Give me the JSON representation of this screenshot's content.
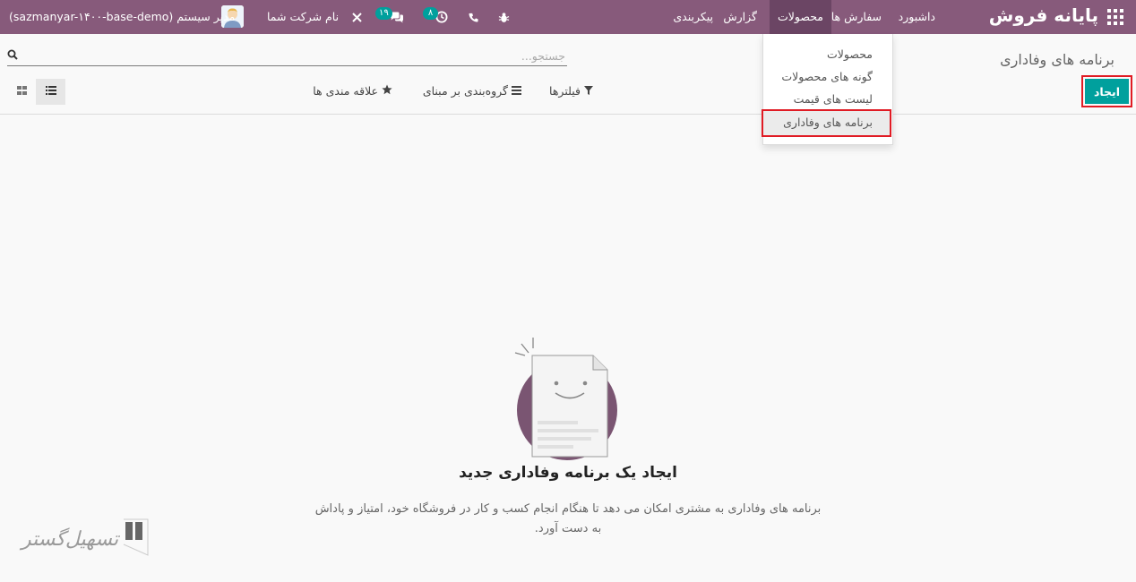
{
  "navbar": {
    "brand": "پایانه فروش",
    "menu": [
      "داشبورد",
      "سفارش ها",
      "محصولات",
      "گزارش",
      "پیکربندی"
    ],
    "active_menu": "محصولات",
    "chat_count": "۱۹",
    "activity_count": "۸",
    "company": "نام شرکت شما",
    "user": "مدیر سیستم (sazmanyar-۱۴۰۰-base-demo)",
    "colors": {
      "bar": "#875a7b",
      "badge": "#00a09d"
    },
    "icons": [
      "apps-grid-icon",
      "bug-icon",
      "phone-icon",
      "clock-icon",
      "chat-icon",
      "tools-icon"
    ]
  },
  "control_panel": {
    "breadcrumb": "برنامه های وفاداری",
    "create_label": "ایجاد",
    "search_placeholder": "جستجو...",
    "filters_label": "فیلترها",
    "groupby_label": "گروه‌بندی بر مبنای",
    "favorites_label": "علاقه مندی ها",
    "views": [
      "list",
      "kanban"
    ],
    "active_view": "list"
  },
  "dropdown": {
    "items": [
      "محصولات",
      "گونه های محصولات",
      "لیست های قیمت",
      "برنامه های وفاداری"
    ],
    "highlighted": "برنامه های وفاداری"
  },
  "empty_state": {
    "title": "ایجاد یک برنامه وفاداری جدید",
    "description_line1": "برنامه های وفاداری به مشتری امکان می دهد تا هنگام انجام کسب و کار در فروشگاه خود، امتیاز و پاداش",
    "description_line2": "به دست آورد."
  },
  "watermark": {
    "text": "تسهیل‌گستر"
  }
}
